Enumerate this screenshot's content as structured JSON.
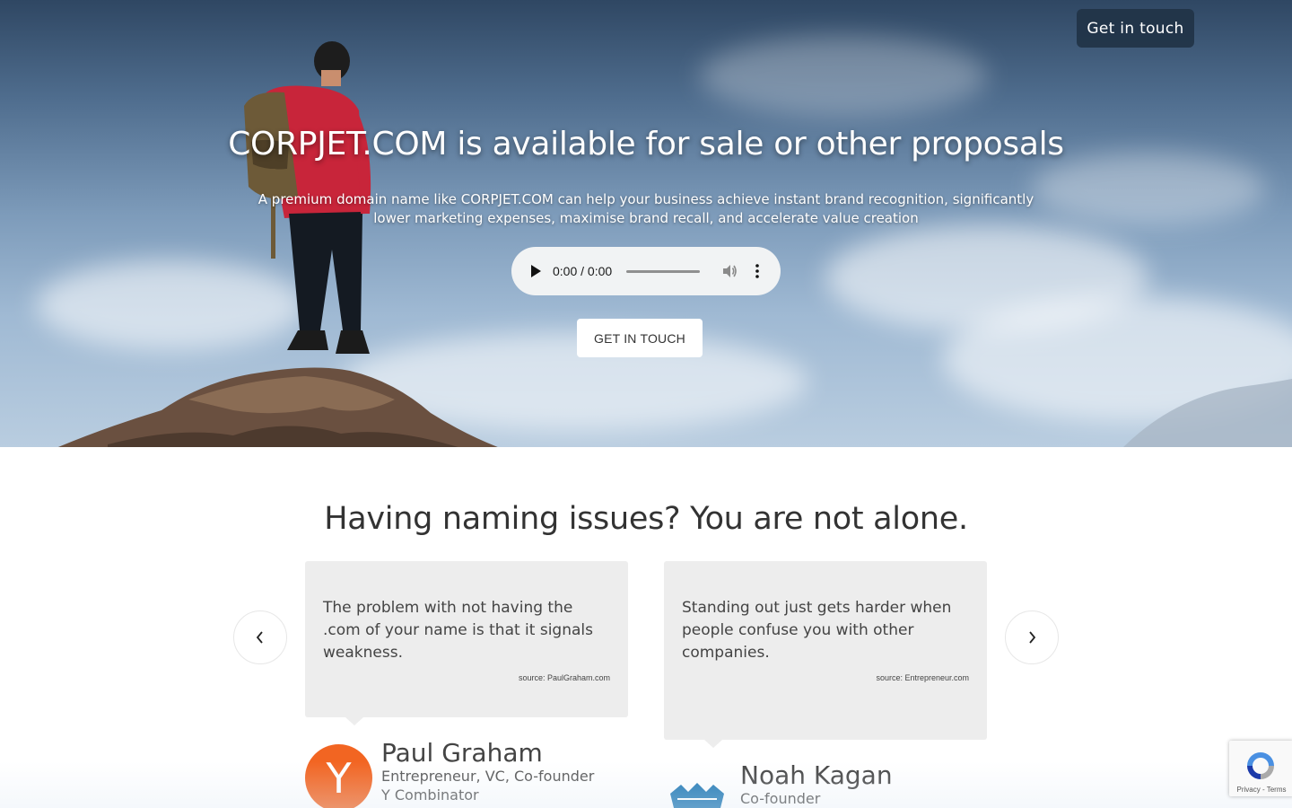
{
  "header": {
    "contact_button": "Get in touch"
  },
  "hero": {
    "title": "CORPJET.COM is available for sale or other proposals",
    "subtitle": "A premium domain name like CORPJET.COM can help your business achieve instant brand recognition, significantly lower marketing expenses, maximise brand recall, and accelerate value creation",
    "audio_time": "0:00 / 0:00",
    "cta_button": "GET IN TOUCH"
  },
  "testimonials": {
    "title": "Having naming issues? You are not alone.",
    "items": [
      {
        "quote": "The problem with not having the .com of your name is that it signals weakness.",
        "source": "source: PaulGraham.com",
        "name": "Paul Graham",
        "role_line1": "Entrepreneur, VC, Co-founder",
        "role_line2": "Y Combinator",
        "avatar_letter": "Y"
      },
      {
        "quote": "Standing out just gets harder when people confuse you with other companies.",
        "source": "source: Entrepreneur.com",
        "name": "Noah Kagan",
        "role_line1": "Co-founder",
        "avatar_icon": "crown-icon"
      }
    ]
  },
  "recaptcha": {
    "links": "Privacy - Terms"
  },
  "colors": {
    "yc_orange": "#f26522",
    "nav_button_bg": "#213346",
    "card_bg": "#ededed",
    "crown_blue": "#1f78b4"
  }
}
